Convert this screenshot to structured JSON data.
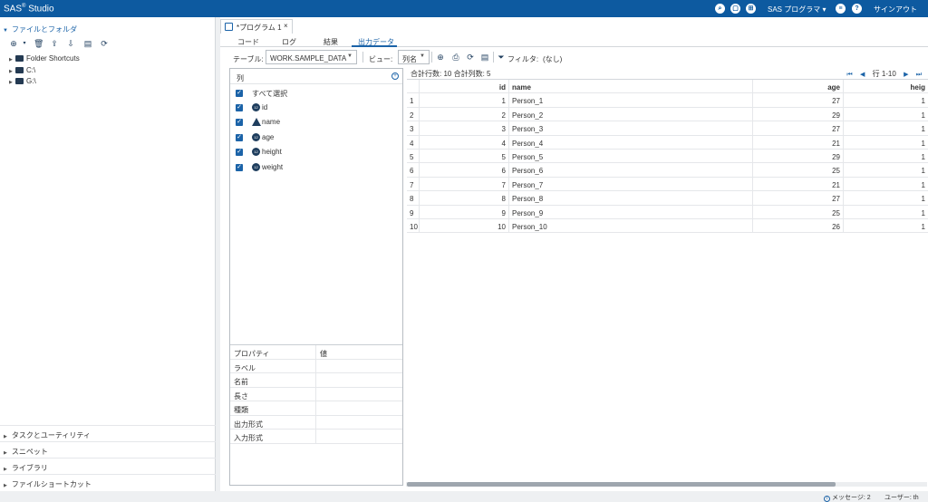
{
  "app": {
    "title": "SAS",
    "title_sup": "®",
    "title_rest": " Studio"
  },
  "topbar": {
    "program_menu": "SAS プログラマ",
    "signout": "サインアウト"
  },
  "left": {
    "section": "ファイルとフォルダ",
    "tree": [
      {
        "label": "Folder Shortcuts"
      },
      {
        "label": "C:\\"
      },
      {
        "label": "G:\\"
      }
    ],
    "bottom_sections": [
      "タスクとユーティリティ",
      "スニペット",
      "ライブラリ",
      "ファイルショートカット"
    ]
  },
  "doctab": {
    "label": "*プログラム 1",
    "close": "×"
  },
  "subtabs": [
    "コード",
    "ログ",
    "結果",
    "出力データ"
  ],
  "toolbar": {
    "table_label": "テーブル:",
    "table_value": "WORK.SAMPLE_DATA",
    "view_label": "ビュー:",
    "view_value": "列名",
    "filter_label": "フィルタ:",
    "filter_value": "(なし)"
  },
  "columns_panel": {
    "header": "列",
    "select_all": "すべて選択",
    "columns": [
      {
        "name": "id",
        "type": "num"
      },
      {
        "name": "name",
        "type": "char"
      },
      {
        "name": "age",
        "type": "num"
      },
      {
        "name": "height",
        "type": "num"
      },
      {
        "name": "weight",
        "type": "num"
      }
    ],
    "props_header": {
      "key": "プロパティ",
      "value": "値"
    },
    "props": [
      "ラベル",
      "名前",
      "長さ",
      "種類",
      "出力形式",
      "入力形式"
    ]
  },
  "data": {
    "info": "合計行数: 10  合計列数: 5",
    "pager_label": "行 1-10",
    "headers": {
      "rn": "",
      "id": "id",
      "name": "name",
      "age": "age",
      "height": "heig"
    },
    "rows": [
      {
        "rn": "1",
        "id": "1",
        "name": "Person_1",
        "age": "27",
        "h": "1"
      },
      {
        "rn": "2",
        "id": "2",
        "name": "Person_2",
        "age": "29",
        "h": "1"
      },
      {
        "rn": "3",
        "id": "3",
        "name": "Person_3",
        "age": "27",
        "h": "1"
      },
      {
        "rn": "4",
        "id": "4",
        "name": "Person_4",
        "age": "21",
        "h": "1"
      },
      {
        "rn": "5",
        "id": "5",
        "name": "Person_5",
        "age": "29",
        "h": "1"
      },
      {
        "rn": "6",
        "id": "6",
        "name": "Person_6",
        "age": "25",
        "h": "1"
      },
      {
        "rn": "7",
        "id": "7",
        "name": "Person_7",
        "age": "21",
        "h": "1"
      },
      {
        "rn": "8",
        "id": "8",
        "name": "Person_8",
        "age": "27",
        "h": "1"
      },
      {
        "rn": "9",
        "id": "9",
        "name": "Person_9",
        "age": "25",
        "h": "1"
      },
      {
        "rn": "10",
        "id": "10",
        "name": "Person_10",
        "age": "26",
        "h": "1"
      }
    ]
  },
  "status": {
    "messages": "メッセージ: 2",
    "user": "ユーザー: th"
  }
}
